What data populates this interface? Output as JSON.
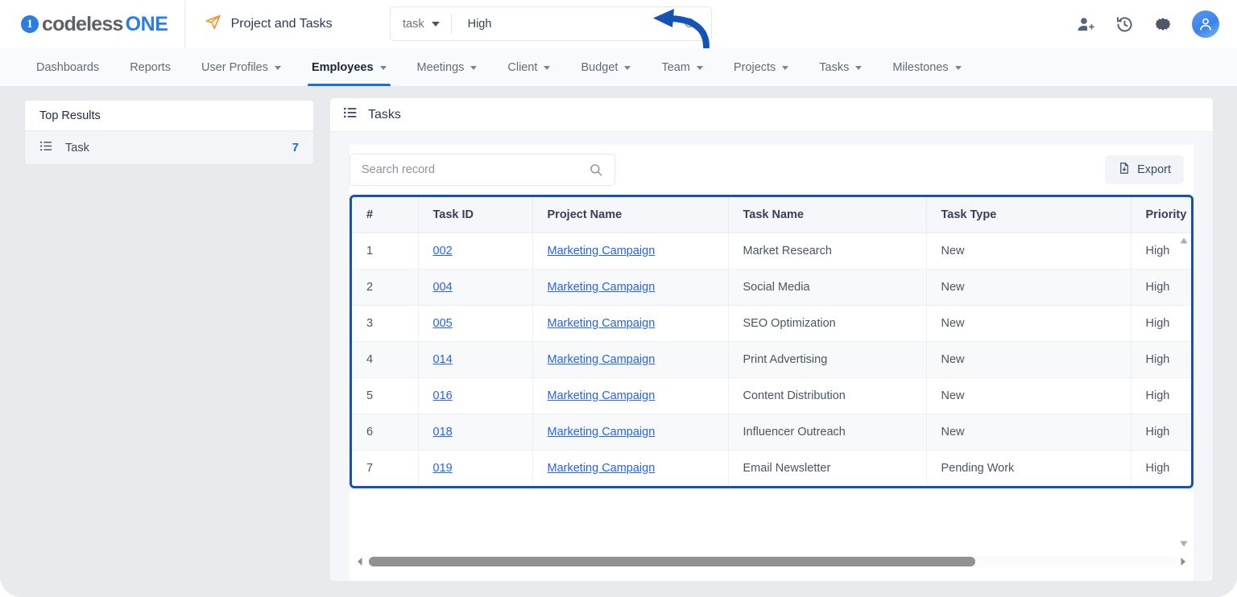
{
  "brand": {
    "logo_part1": "codeless",
    "logo_part2": "ONE",
    "logo_badge": "1",
    "accent": "#2a7de1"
  },
  "header": {
    "app_icon": "paper-plane-icon",
    "app_title": "Project and Tasks",
    "search": {
      "scope_label": "task",
      "value": "High",
      "placeholder": "",
      "search_icon": "search-icon"
    },
    "icons": [
      {
        "name": "add-user-icon"
      },
      {
        "name": "history-icon"
      },
      {
        "name": "gear-icon"
      },
      {
        "name": "user-avatar-icon"
      }
    ],
    "annotation": {
      "name": "blue-curved-arrow",
      "color": "#1552b5"
    }
  },
  "nav": {
    "items": [
      {
        "label": "Dashboards",
        "dropdown": false,
        "active": false
      },
      {
        "label": "Reports",
        "dropdown": false,
        "active": false
      },
      {
        "label": "User Profiles",
        "dropdown": true,
        "active": false
      },
      {
        "label": "Employees",
        "dropdown": true,
        "active": true
      },
      {
        "label": "Meetings",
        "dropdown": true,
        "active": false
      },
      {
        "label": "Client",
        "dropdown": true,
        "active": false
      },
      {
        "label": "Budget",
        "dropdown": true,
        "active": false
      },
      {
        "label": "Team",
        "dropdown": true,
        "active": false
      },
      {
        "label": "Projects",
        "dropdown": true,
        "active": false
      },
      {
        "label": "Tasks",
        "dropdown": true,
        "active": false
      },
      {
        "label": "Milestones",
        "dropdown": true,
        "active": false
      }
    ],
    "active_underline_color": "#1a6fe0"
  },
  "sidebar": {
    "heading": "Top Results",
    "items": [
      {
        "icon": "list-icon",
        "label": "Task",
        "count": "7"
      }
    ],
    "count_color": "#1a6fe0"
  },
  "main": {
    "panel_icon": "list-icon",
    "panel_title": "Tasks",
    "record_search": {
      "placeholder": "Search record",
      "value": ""
    },
    "export": {
      "label": "Export",
      "icon": "file-download-icon"
    },
    "table": {
      "highlight_color": "#1552b5",
      "columns": [
        "#",
        "Task ID",
        "Project Name",
        "Task Name",
        "Task Type",
        "Priority"
      ],
      "rows": [
        {
          "num": "1",
          "task_id": "002",
          "project_name": "Marketing Campaign",
          "task_name": "Market Research",
          "task_type": "New",
          "priority": "High"
        },
        {
          "num": "2",
          "task_id": "004",
          "project_name": "Marketing Campaign",
          "task_name": "Social Media",
          "task_type": "New",
          "priority": "High"
        },
        {
          "num": "3",
          "task_id": "005",
          "project_name": "Marketing Campaign",
          "task_name": "SEO Optimization",
          "task_type": "New",
          "priority": "High"
        },
        {
          "num": "4",
          "task_id": "014",
          "project_name": "Marketing Campaign",
          "task_name": "Print Advertising",
          "task_type": "New",
          "priority": "High"
        },
        {
          "num": "5",
          "task_id": "016",
          "project_name": "Marketing Campaign",
          "task_name": "Content Distribution",
          "task_type": "New",
          "priority": "High"
        },
        {
          "num": "6",
          "task_id": "018",
          "project_name": "Marketing Campaign",
          "task_name": "Influencer Outreach",
          "task_type": "New",
          "priority": "High"
        },
        {
          "num": "7",
          "task_id": "019",
          "project_name": "Marketing Campaign",
          "task_name": "Email Newsletter",
          "task_type": "Pending Work",
          "priority": "High"
        }
      ]
    },
    "scrollbars": {
      "horizontal_thumb_percent": "75",
      "vertical_up_icon": "triangle-up-icon",
      "vertical_down_icon": "triangle-down-icon",
      "h_left_icon": "triangle-left-icon",
      "h_right_icon": "triangle-right-icon"
    }
  }
}
